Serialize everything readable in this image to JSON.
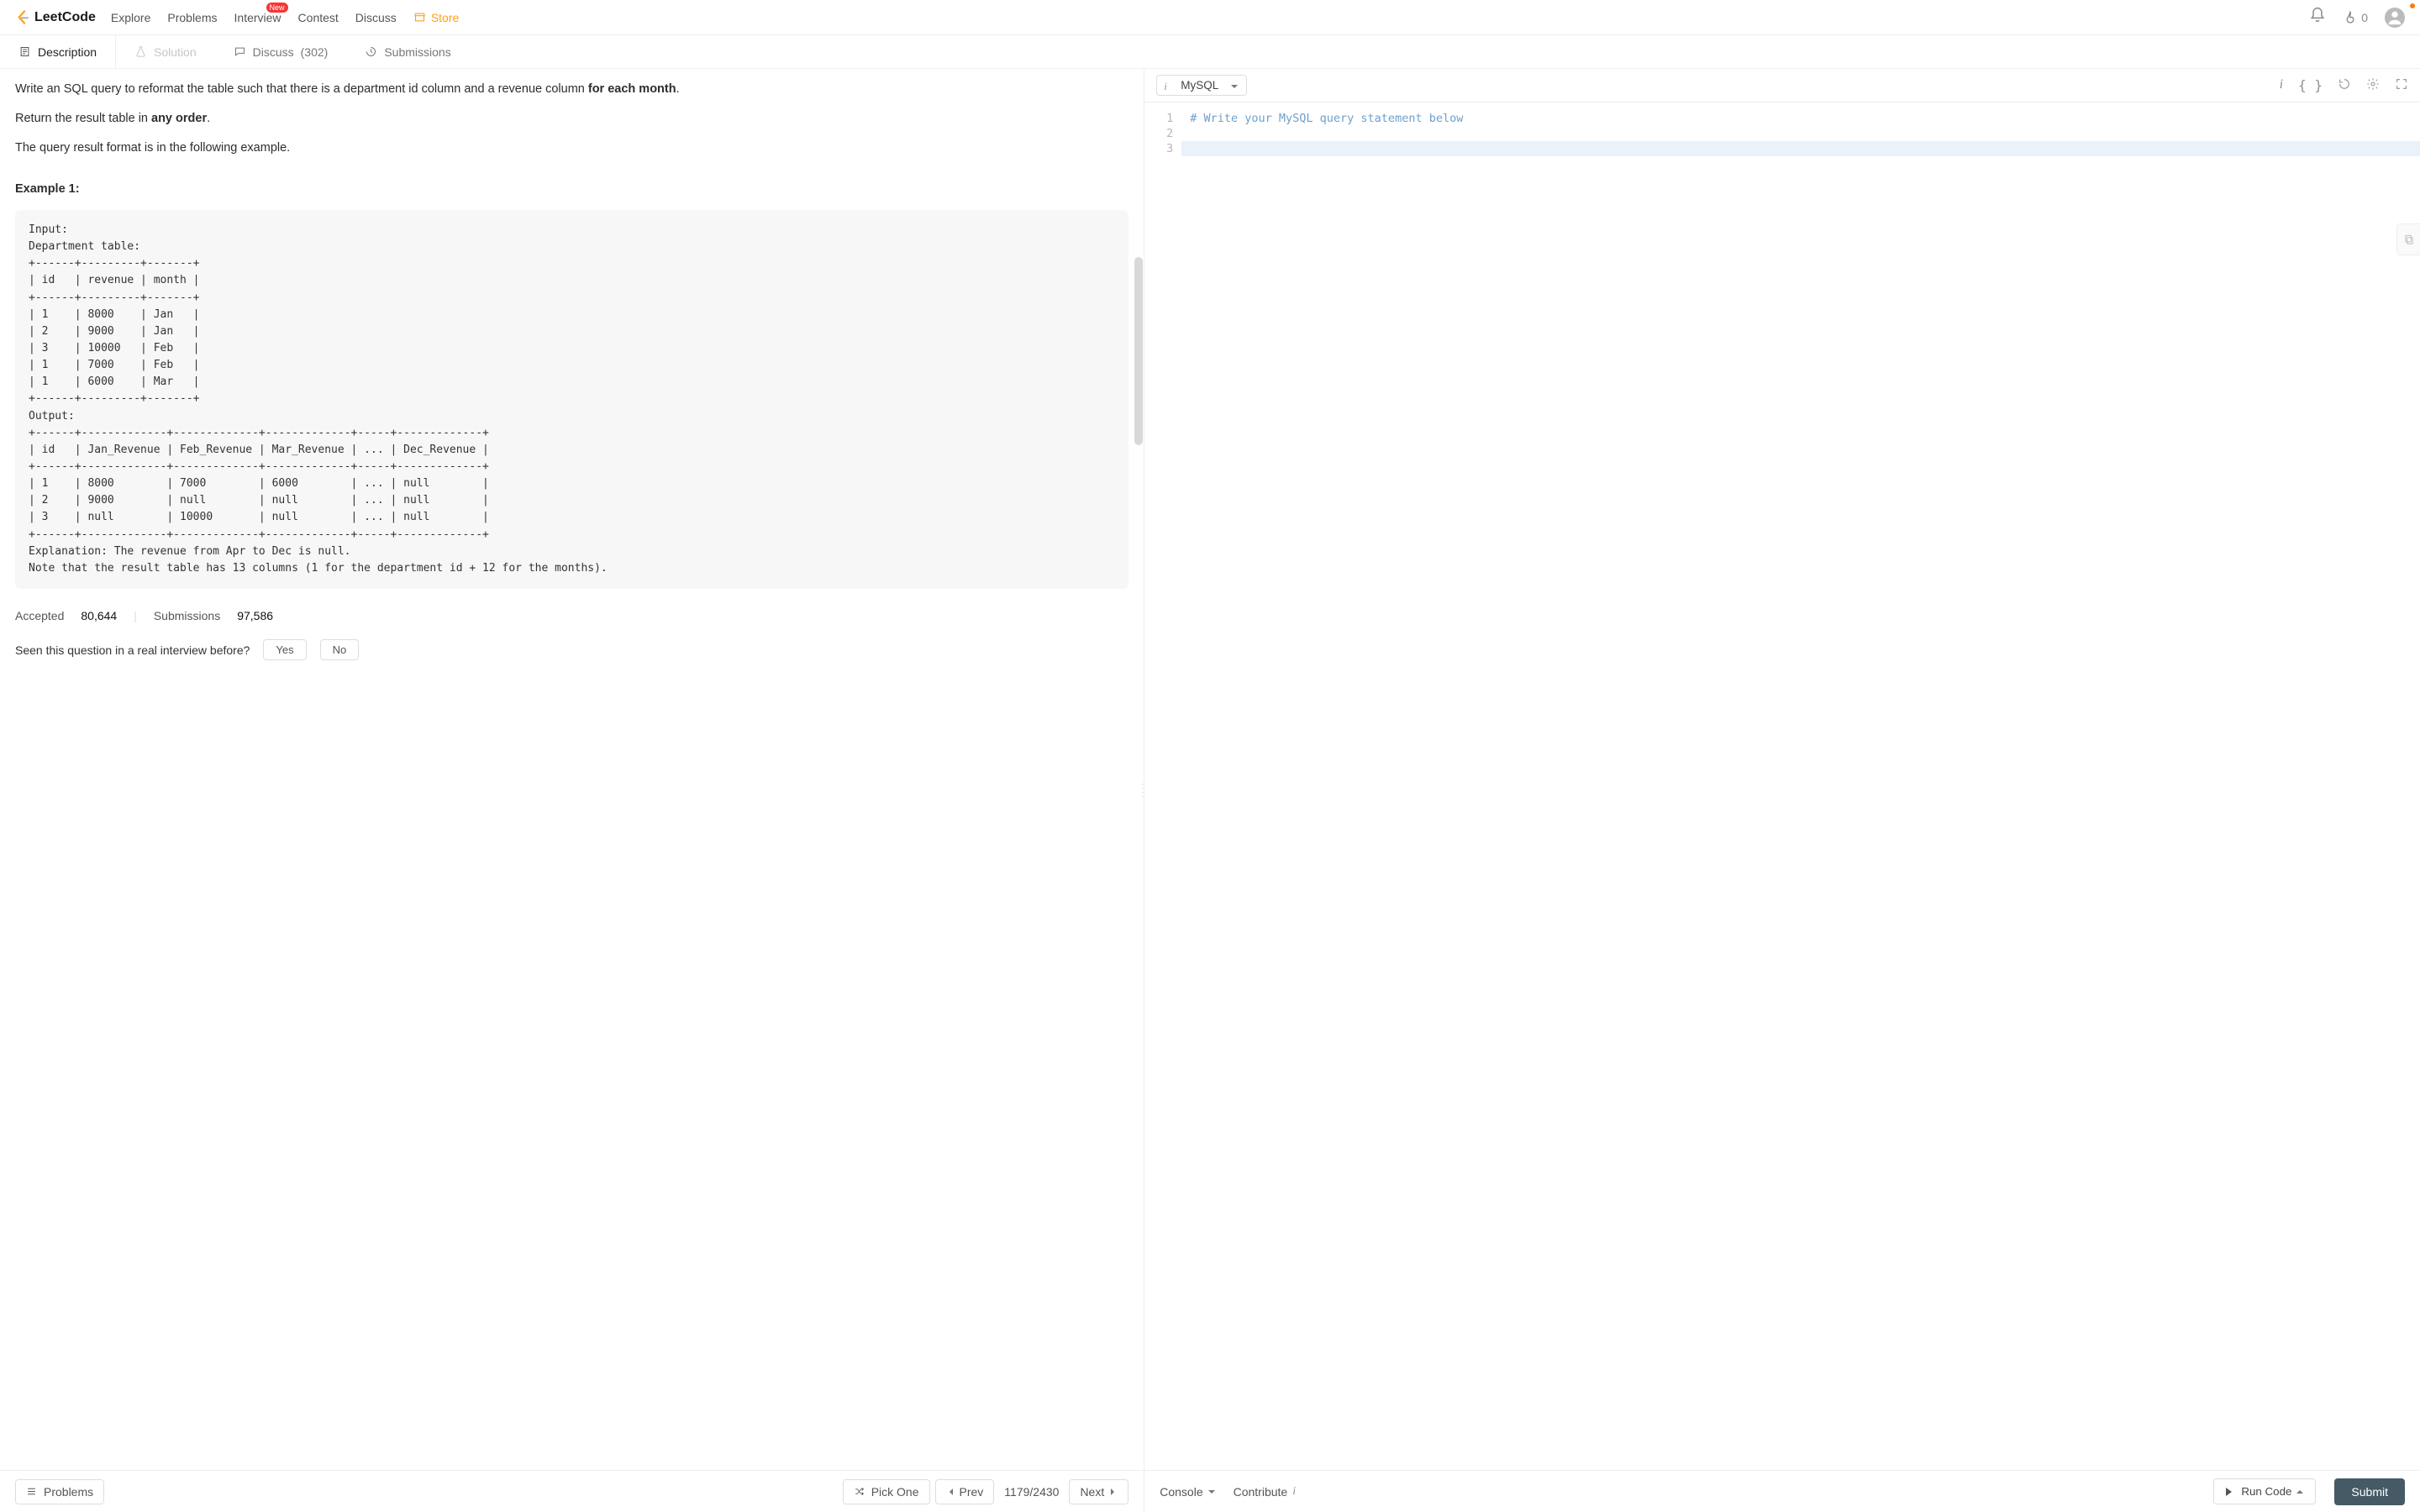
{
  "brand": "LeetCode",
  "nav": {
    "explore": "Explore",
    "problems": "Problems",
    "interview": "Interview",
    "interview_badge": "New",
    "contest": "Contest",
    "discuss": "Discuss",
    "store": "Store",
    "streak": "0"
  },
  "tabs": {
    "description": "Description",
    "solution": "Solution",
    "discuss_label": "Discuss",
    "discuss_count": "(302)",
    "submissions": "Submissions"
  },
  "problem": {
    "p1_a": "Write an SQL query to reformat the table such that there is a department id column and a revenue column ",
    "p1_bold": "for each month",
    "p1_b": ".",
    "p2_a": "Return the result table in ",
    "p2_bold": "any order",
    "p2_b": ".",
    "p3": "The query result format is in the following example.",
    "example_heading": "Example 1:",
    "example_block": "Input: \nDepartment table:\n+------+---------+-------+\n| id   | revenue | month |\n+------+---------+-------+\n| 1    | 8000    | Jan   |\n| 2    | 9000    | Jan   |\n| 3    | 10000   | Feb   |\n| 1    | 7000    | Feb   |\n| 1    | 6000    | Mar   |\n+------+---------+-------+\nOutput: \n+------+-------------+-------------+-------------+-----+-------------+\n| id   | Jan_Revenue | Feb_Revenue | Mar_Revenue | ... | Dec_Revenue |\n+------+-------------+-------------+-------------+-----+-------------+\n| 1    | 8000        | 7000        | 6000        | ... | null        |\n| 2    | 9000        | null        | null        | ... | null        |\n| 3    | null        | 10000       | null        | ... | null        |\n+------+-------------+-------------+-------------+-----+-------------+\nExplanation: The revenue from Apr to Dec is null.\nNote that the result table has 13 columns (1 for the department id + 12 for the months).",
    "accepted_label": "Accepted",
    "accepted_value": "80,644",
    "submissions_label": "Submissions",
    "submissions_value": "97,586",
    "seen_prompt": "Seen this question in a real interview before?",
    "yes": "Yes",
    "no": "No"
  },
  "left_footer": {
    "problems": "Problems",
    "pick_one": "Pick One",
    "prev": "Prev",
    "counter": "1179/2430",
    "next": "Next"
  },
  "editor": {
    "language": "MySQL",
    "line1": "# Write your MySQL query statement below",
    "gutter": [
      "1",
      "2",
      "3"
    ]
  },
  "right_footer": {
    "console": "Console",
    "contribute": "Contribute",
    "run": "Run Code",
    "submit": "Submit"
  }
}
